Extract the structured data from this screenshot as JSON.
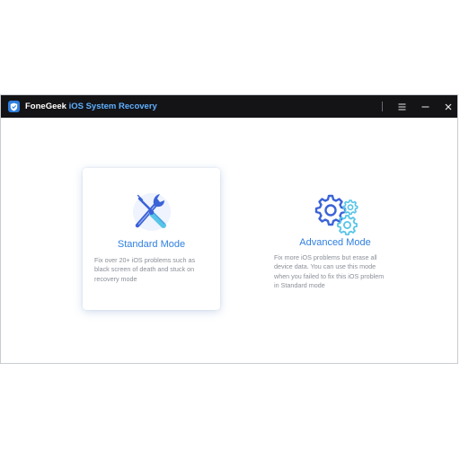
{
  "window": {
    "title_brand": "FoneGeek",
    "title_product": "iOS System Recovery",
    "logo_icon": "shield-icon",
    "menu_icon": "menu-icon",
    "minimize_icon": "minimize-icon",
    "close_icon": "close-icon"
  },
  "modes": [
    {
      "title": "Standard Mode",
      "icon": "tools-icon",
      "description_lines": [
        "Fix over 20+ iOS problems such as",
        "black screen of death and stuck on",
        "recovery mode"
      ],
      "selected": true
    },
    {
      "title": "Advanced Mode",
      "icon": "gears-icon",
      "description_lines": [
        "Fix more iOS problems but erase all",
        "device data. You can use this mode",
        "when you failed to fix this iOS problem",
        "in Standard mode"
      ],
      "selected": false
    }
  ],
  "colors": {
    "titlebar": "#141417",
    "accent": "#2f7fe0",
    "product_title": "#5fb0ff",
    "description": "#8a8f98"
  }
}
